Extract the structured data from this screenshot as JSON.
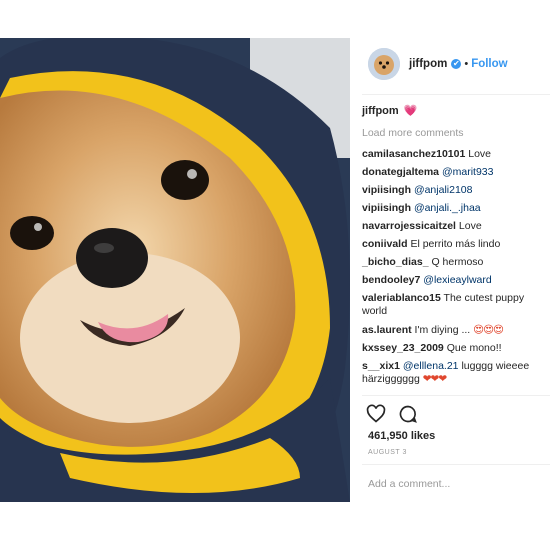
{
  "post": {
    "username": "jiffpom",
    "verified_badge": "✔",
    "separator": "•",
    "follow_label": "Follow",
    "caption_user": "jiffpom",
    "caption_emoji": "💗",
    "load_more": "Load more comments",
    "likes": "461,950 likes",
    "date": "AUGUST 3",
    "add_comment_placeholder": "Add a comment..."
  },
  "comments": [
    {
      "user": "camilasanchez10101",
      "mention": "",
      "text": "Love"
    },
    {
      "user": "donategjaltema",
      "mention": "@marit933",
      "text": ""
    },
    {
      "user": "vipiisingh",
      "mention": "@anjali2108",
      "text": ""
    },
    {
      "user": "vipiisingh",
      "mention": "@anjali._.jhaa",
      "text": ""
    },
    {
      "user": "navarrojessicaitzel",
      "mention": "",
      "text": "Love"
    },
    {
      "user": "coniivald",
      "mention": "",
      "text": "El perrito más lindo"
    },
    {
      "user": "_bicho_dias_",
      "mention": "",
      "text": "Q hermoso"
    },
    {
      "user": "bendooley7",
      "mention": "@lexieaylward",
      "text": ""
    },
    {
      "user": "valeriablanco15",
      "mention": "",
      "text": "The cutest puppy world"
    },
    {
      "user": "as.laurent",
      "mention": "",
      "text": "I'm diying ...",
      "emoji": "😍😍😍"
    },
    {
      "user": "kxssey_23_2009",
      "mention": "",
      "text": "Que mono!!"
    },
    {
      "user": "s__xix1",
      "mention": "@elllena.21",
      "text": "lugggg wieeee härzigggggg",
      "emoji": "❤❤❤"
    }
  ],
  "icons": {
    "like": "heart-outline-icon",
    "comment": "speech-bubble-icon"
  },
  "colors": {
    "link_blue": "#3897f0",
    "mention": "#003569",
    "muted": "#999999",
    "hood": "#27344f",
    "lining": "#f2c21b"
  }
}
